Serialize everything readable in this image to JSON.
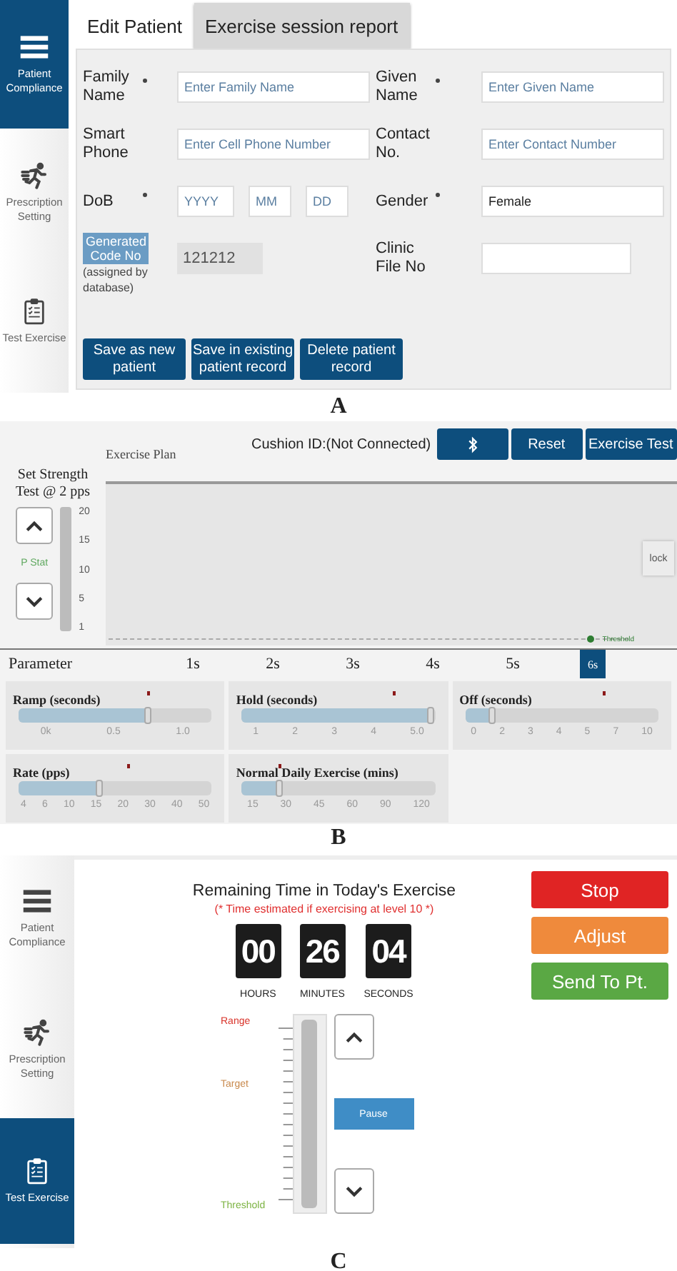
{
  "panel_a": {
    "caption": "A",
    "sidebar": [
      {
        "kind": "menu",
        "label": "Patient Compliance",
        "selected": true
      },
      {
        "kind": "runner",
        "label": "Prescription Setting",
        "selected": false
      },
      {
        "kind": "clipboard",
        "label": "Test Exercise",
        "selected": false
      }
    ],
    "tabs": [
      {
        "label": "Edit Patient",
        "selected": true
      },
      {
        "label": "Exercise session report",
        "selected": false
      }
    ],
    "fields": [
      {
        "kind": "text",
        "label": "Family Name",
        "required": true,
        "placeholder": "Enter Family Name"
      },
      {
        "kind": "text",
        "label": "Given Name",
        "required": true,
        "placeholder": "Enter Given Name"
      },
      {
        "kind": "text",
        "label": "Smart Phone",
        "required": false,
        "placeholder": "Enter Cell Phone Number"
      },
      {
        "kind": "text",
        "label": "Contact No.",
        "required": false,
        "placeholder": "Enter Contact Number"
      },
      {
        "kind": "date",
        "label": "DoB",
        "required": true,
        "parts": [
          {
            "placeholder": "YYYY"
          },
          {
            "placeholder": "MM"
          },
          {
            "placeholder": "DD"
          }
        ]
      },
      {
        "kind": "value",
        "label": "Gender",
        "required": true,
        "value": "Female"
      },
      {
        "kind": "code",
        "label": "Generated Code No",
        "note": "(assigned by database)",
        "value": "121212",
        "required": false
      },
      {
        "kind": "blank",
        "label": "Clinic File No",
        "required": false
      }
    ],
    "buttons": [
      "Save as new patient",
      "Save in existing patient record",
      "Delete patient record"
    ]
  },
  "panel_b": {
    "caption": "B",
    "plan_title": "Exercise Plan",
    "cushion_status": "Cushion ID:(Not Connected)",
    "buttons": [
      {
        "kind": "bluetooth"
      },
      {
        "kind": "text",
        "label": "Reset"
      },
      {
        "kind": "text",
        "label": "Exercise Test"
      }
    ],
    "strength": {
      "title": "Set Strength Test @ 2 pps",
      "scale": [
        "20",
        "15",
        "10",
        "5",
        "1"
      ],
      "status": "P Stat"
    },
    "threshold_label": "Threshold",
    "lock_label": "lock",
    "parameter_label": "Parameter",
    "steps": [
      {
        "label": "1s",
        "selected": false
      },
      {
        "label": "2s",
        "selected": false
      },
      {
        "label": "3s",
        "selected": false
      },
      {
        "label": "4s",
        "selected": false
      },
      {
        "label": "5s",
        "selected": false
      },
      {
        "label": "6s",
        "selected": true
      }
    ],
    "sliders": [
      {
        "title": "Ramp (seconds)",
        "level": 0.67,
        "marker": {
          "level": 0.67
        },
        "ticks": [
          "0k",
          "0.5",
          "1.0"
        ]
      },
      {
        "title": "Hold (seconds)",
        "level": 0.98,
        "marker": {
          "level": 0.79
        },
        "ticks": [
          "1",
          "2",
          "3",
          "4",
          "5.0"
        ]
      },
      {
        "title": "Off (seconds)",
        "level": 0.14,
        "marker": {
          "level": 0.72
        },
        "ticks": [
          "0",
          "2",
          "3",
          "4",
          "5",
          "7",
          "10"
        ]
      },
      {
        "title": "Rate (pps)",
        "level": 0.42,
        "marker": {
          "level": 0.57
        },
        "ticks": [
          "4",
          "6",
          "10",
          "15",
          "20",
          "30",
          "40",
          "50"
        ]
      },
      {
        "title": "Normal Daily Exercise (mins)",
        "level": 0.2,
        "marker": {
          "level": 0.2
        },
        "ticks": [
          "15",
          "30",
          "45",
          "60",
          "90",
          "120"
        ]
      }
    ]
  },
  "panel_c": {
    "caption": "C",
    "sidebar": [
      {
        "kind": "menu",
        "label": "Patient Compliance",
        "selected": false
      },
      {
        "kind": "runner",
        "label": "Prescription Setting",
        "selected": false
      },
      {
        "kind": "clipboard",
        "label": "Test Exercise",
        "selected": true
      }
    ],
    "title": "Remaining Time in Today's Exercise",
    "note": "(* Time estimated if exercising at level 10 *)",
    "countdown": [
      {
        "value": "00",
        "unit": "HOURS"
      },
      {
        "value": "26",
        "unit": "MINUTES"
      },
      {
        "value": "04",
        "unit": "SECONDS"
      }
    ],
    "levels": [
      {
        "label": "Range",
        "color": "#d9342b"
      },
      {
        "label": "Target",
        "color": "#c98a4e"
      },
      {
        "label": "Threshold",
        "color": "#7cb342"
      }
    ],
    "slider": {
      "level": 1
    },
    "pause_label": "Pause",
    "actions": [
      {
        "label": "Stop",
        "color": "#e02424"
      },
      {
        "label": "Adjust",
        "color": "#ef8a3c"
      },
      {
        "label": "Send To Pt.",
        "color": "#5aa844"
      }
    ]
  }
}
